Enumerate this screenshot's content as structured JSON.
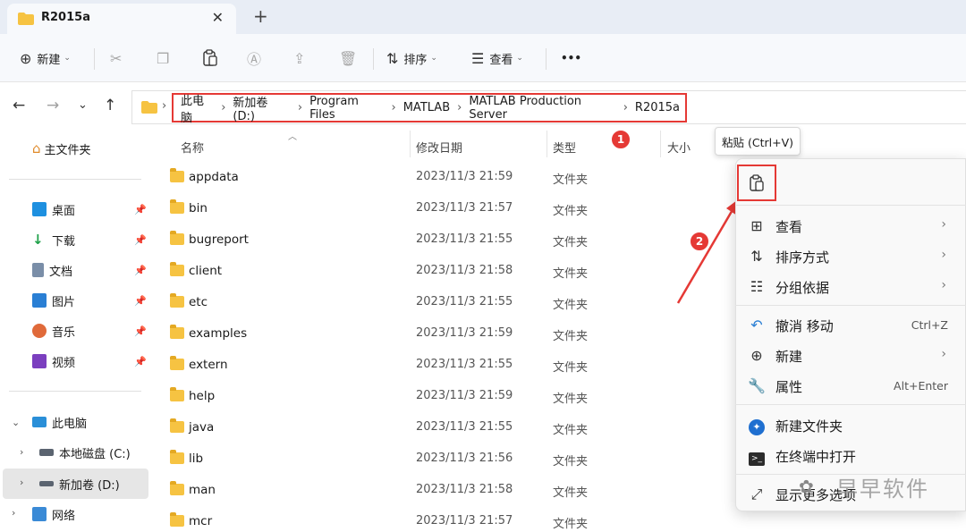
{
  "tab": {
    "title": "R2015a",
    "close": "✕",
    "new": "+"
  },
  "command_bar": {
    "new_label": "新建",
    "sort_label": "排序",
    "view_label": "查看",
    "more": "•••"
  },
  "address": {
    "crumbs": [
      "此电脑",
      "新加卷 (D:)",
      "Program Files",
      "MATLAB",
      "MATLAB Production Server",
      "R2015a"
    ],
    "sep": "›"
  },
  "sidebar": {
    "home": "主文件夹",
    "quick": [
      {
        "label": "桌面",
        "color": "#1e90e0"
      },
      {
        "label": "下载",
        "color": "#1fa14a"
      },
      {
        "label": "文档",
        "color": "#7a8ea8"
      },
      {
        "label": "图片",
        "color": "#2a7fd4"
      },
      {
        "label": "音乐",
        "color": "#e06a3a"
      },
      {
        "label": "视频",
        "color": "#7b3fbf"
      }
    ],
    "this_pc": "此电脑",
    "drives": [
      "本地磁盘 (C:)",
      "新加卷 (D:)"
    ],
    "network": "网络"
  },
  "columns": {
    "name": "名称",
    "date": "修改日期",
    "type": "类型",
    "size": "大小"
  },
  "files": [
    {
      "name": "appdata",
      "date": "2023/11/3 21:59",
      "type": "文件夹"
    },
    {
      "name": "bin",
      "date": "2023/11/3 21:57",
      "type": "文件夹"
    },
    {
      "name": "bugreport",
      "date": "2023/11/3 21:55",
      "type": "文件夹"
    },
    {
      "name": "client",
      "date": "2023/11/3 21:58",
      "type": "文件夹"
    },
    {
      "name": "etc",
      "date": "2023/11/3 21:55",
      "type": "文件夹"
    },
    {
      "name": "examples",
      "date": "2023/11/3 21:59",
      "type": "文件夹"
    },
    {
      "name": "extern",
      "date": "2023/11/3 21:55",
      "type": "文件夹"
    },
    {
      "name": "help",
      "date": "2023/11/3 21:59",
      "type": "文件夹"
    },
    {
      "name": "java",
      "date": "2023/11/3 21:55",
      "type": "文件夹"
    },
    {
      "name": "lib",
      "date": "2023/11/3 21:56",
      "type": "文件夹"
    },
    {
      "name": "man",
      "date": "2023/11/3 21:58",
      "type": "文件夹"
    },
    {
      "name": "mcr",
      "date": "2023/11/3 21:57",
      "type": "文件夹"
    }
  ],
  "badges": {
    "one": "1",
    "two": "2"
  },
  "tooltip": "粘贴 (Ctrl+V)",
  "menu": {
    "view": "查看",
    "sort": "排序方式",
    "group": "分组依据",
    "undo": "撤消 移动",
    "undo_key": "Ctrl+Z",
    "new": "新建",
    "props": "属性",
    "props_key": "Alt+Enter",
    "new_folder": "新建文件夹",
    "terminal": "在终端中打开",
    "more": "显示更多选项"
  },
  "watermark": "早早软件",
  "accent": "#e53935"
}
